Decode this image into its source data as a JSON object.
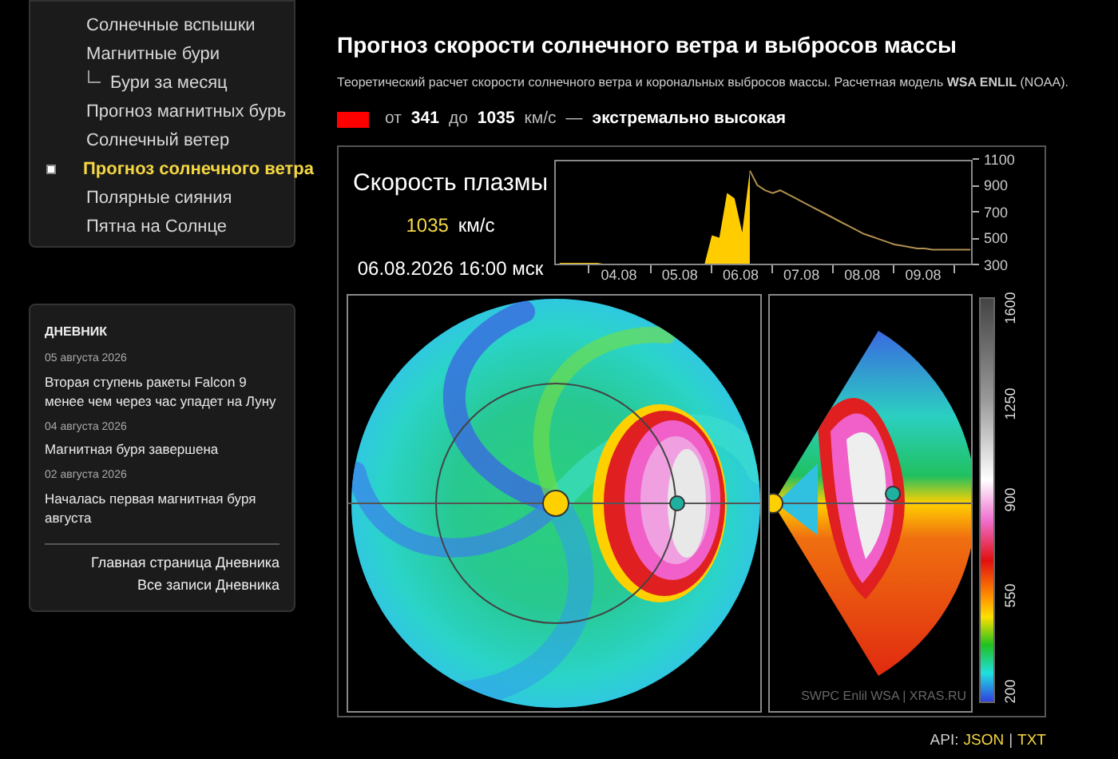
{
  "nav": {
    "items": [
      {
        "label": "Солнечные вспышки",
        "selected": false
      },
      {
        "label": "Магнитные бури",
        "selected": false,
        "children": [
          {
            "label": "Бури за месяц",
            "selected": false
          }
        ]
      },
      {
        "label": "Прогноз магнитных бурь",
        "selected": false
      },
      {
        "label": "Солнечный ветер",
        "selected": false
      },
      {
        "label": "Прогноз солнечного ветра",
        "selected": true
      },
      {
        "label": "Полярные сияния",
        "selected": false
      },
      {
        "label": "Пятна на Солнце",
        "selected": false
      }
    ]
  },
  "diary": {
    "title": "ДНЕВНИК",
    "entries": [
      {
        "date": "05 августа 2026",
        "title": "Вторая ступень ракеты Falcon 9 менее чем через час упадет на Луну"
      },
      {
        "date": "04 августа 2026",
        "title": "Магнитная буря завершена"
      },
      {
        "date": "02 августа 2026",
        "title": "Началась первая магнитная буря августа"
      }
    ],
    "links": [
      "Главная страница Дневника",
      "Все записи Дневника"
    ]
  },
  "page": {
    "title": "Прогноз скорости солнечного ветра и выбросов массы",
    "description": "Теоретический расчет скорости солнечного ветра и корональных выбросов массы. Расчетная модель **WSA ENLIL** (NOAA).",
    "forecast": {
      "color": "#ff0000",
      "from_label": "от",
      "from": "341",
      "to_label": "до",
      "to": "1035",
      "unit": "км/с",
      "dash": "—",
      "level_text": "экстремально высокая"
    }
  },
  "plasma": {
    "title": "Скорость плазмы",
    "value": "1035",
    "unit": "км/с",
    "datetime": "06.08.2026 16:00 мск",
    "chart_data": {
      "type": "area",
      "categories": [
        null,
        null,
        null,
        null,
        null,
        null,
        null,
        null,
        "04.08",
        null,
        null,
        null,
        null,
        null,
        null,
        null,
        "05.08",
        null,
        null,
        null,
        null,
        null,
        null,
        null,
        "06.08",
        null,
        null,
        null,
        null,
        null,
        null,
        null,
        "07.08",
        null,
        null,
        null,
        null,
        null,
        null,
        null,
        "08.08",
        null,
        null,
        null,
        null,
        null,
        null,
        null,
        "09.08",
        null,
        null,
        null,
        null,
        null,
        null
      ],
      "series": [
        {
          "type": "area",
          "color": "#ffcc00",
          "values": [
            330,
            330,
            330,
            330,
            330,
            330,
            320,
            320,
            320,
            320,
            320,
            320,
            320,
            320,
            320,
            320,
            310,
            310,
            310,
            310,
            540,
            520,
            860,
            820,
            560,
            1030,
            null,
            null,
            null,
            null,
            null,
            null,
            null,
            null,
            null,
            null,
            null,
            null,
            null,
            null,
            null,
            null,
            null,
            null,
            null,
            null,
            null,
            null,
            null,
            null,
            null,
            null,
            null,
            null,
            null
          ]
        },
        {
          "type": "line",
          "color": "#b09050",
          "values": [
            null,
            null,
            null,
            null,
            null,
            null,
            null,
            null,
            null,
            null,
            null,
            null,
            null,
            null,
            null,
            null,
            null,
            null,
            null,
            null,
            null,
            null,
            null,
            null,
            null,
            1030,
            920,
            880,
            860,
            880,
            850,
            820,
            790,
            760,
            730,
            700,
            670,
            640,
            610,
            580,
            550,
            530,
            510,
            490,
            470,
            460,
            450,
            440,
            440,
            430,
            430,
            430,
            430,
            430,
            430
          ]
        }
      ],
      "ylim": [
        300,
        1100
      ],
      "yticks": [
        300,
        500,
        700,
        900,
        1100
      ]
    }
  },
  "color_scale": {
    "ticks": [
      "1600",
      "1250",
      "900",
      "550",
      "200"
    ]
  },
  "credit": "SWPC Enlil WSA | XRAS.RU",
  "api": {
    "label": "API:",
    "links": [
      "JSON",
      "TXT"
    ],
    "separator": "|"
  }
}
